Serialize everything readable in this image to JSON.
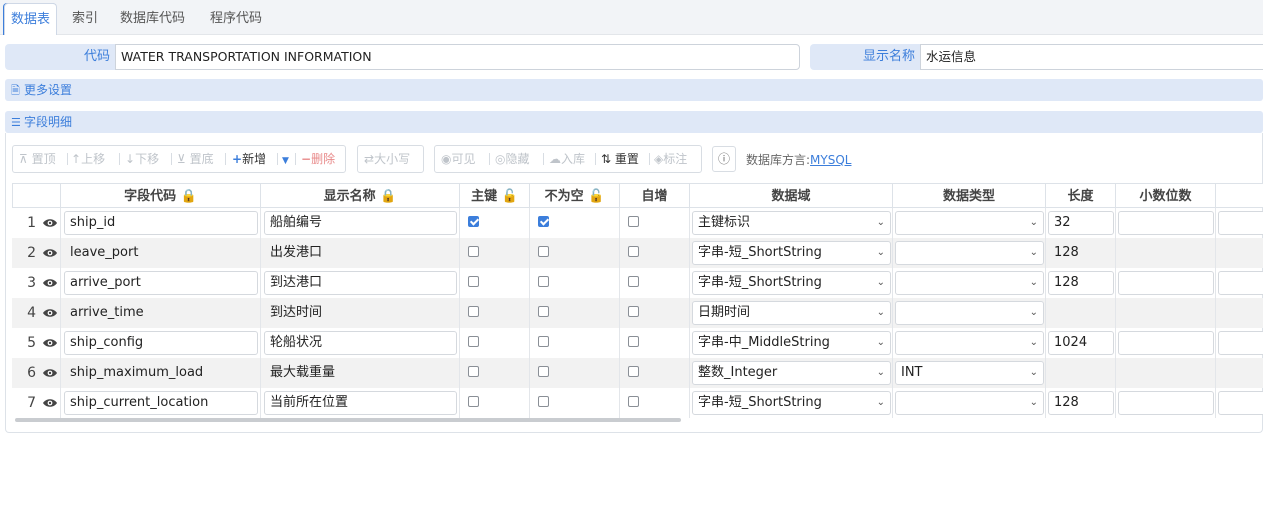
{
  "tabs": [
    "数据表",
    "索引",
    "数据库代码",
    "程序代码"
  ],
  "form": {
    "code_label": "代码",
    "code_value": "WATER TRANSPORTATION INFORMATION",
    "display_label": "显示名称",
    "display_value": "水运信息"
  },
  "sections": {
    "more": "更多设置",
    "fields": "字段明细"
  },
  "toolbar": {
    "top": "置顶",
    "up": "上移",
    "down": "下移",
    "bottom": "置底",
    "add": "新增",
    "delete": "删除",
    "case": "大小写",
    "visible": "可见",
    "hide": "隐藏",
    "import": "入库",
    "reset": "重置",
    "mark": "标注"
  },
  "dialect": {
    "label": "数据库方言:",
    "value": "MYSQL"
  },
  "columns": [
    "字段代码",
    "显示名称",
    "主键",
    "不为空",
    "自增",
    "数据域",
    "数据类型",
    "长度",
    "小数位数"
  ],
  "rows": [
    {
      "num": "1",
      "code": "ship_id",
      "name": "船舶编号",
      "pk": true,
      "notnull": true,
      "auto": false,
      "domain": "主键标识",
      "type": "",
      "length": "32"
    },
    {
      "num": "2",
      "code": "leave_port",
      "name": "出发港口",
      "pk": false,
      "notnull": false,
      "auto": false,
      "domain": "字串-短_ShortString",
      "type": "",
      "length": "128"
    },
    {
      "num": "3",
      "code": "arrive_port",
      "name": "到达港口",
      "pk": false,
      "notnull": false,
      "auto": false,
      "domain": "字串-短_ShortString",
      "type": "",
      "length": "128"
    },
    {
      "num": "4",
      "code": "arrive_time",
      "name": "到达时间",
      "pk": false,
      "notnull": false,
      "auto": false,
      "domain": "日期时间",
      "type": "",
      "length": ""
    },
    {
      "num": "5",
      "code": "ship_config",
      "name": "轮船状况",
      "pk": false,
      "notnull": false,
      "auto": false,
      "domain": "字串-中_MiddleString",
      "type": "",
      "length": "1024"
    },
    {
      "num": "6",
      "code": "ship_maximum_load",
      "name": "最大载重量",
      "pk": false,
      "notnull": false,
      "auto": false,
      "domain": "整数_Integer",
      "type": "INT",
      "length": ""
    },
    {
      "num": "7",
      "code": "ship_current_location",
      "name": "当前所在位置",
      "pk": false,
      "notnull": false,
      "auto": false,
      "domain": "字串-短_ShortString",
      "type": "",
      "length": "128"
    }
  ],
  "colors": {
    "accent": "#3c7edb",
    "label_bg": "#dfe8f7"
  }
}
